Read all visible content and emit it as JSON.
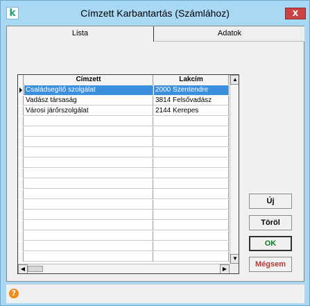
{
  "window": {
    "title": "Címzett Karbantartás (Számlához)",
    "app_icon": "k",
    "close_label": "X"
  },
  "tabs": [
    {
      "label": "Lista",
      "active": true
    },
    {
      "label": "Adatok",
      "active": false
    }
  ],
  "grid": {
    "columns": [
      "Címzett",
      "Lakcím"
    ],
    "rows": [
      {
        "cimzett": "Családsegítő szolgálat",
        "lakcim": "2000 Szentendre",
        "selected": true
      },
      {
        "cimzett": "Vadász társaság",
        "lakcim": "3814 Felsővadász",
        "selected": false
      },
      {
        "cimzett": "Városi járőrszolgálat",
        "lakcim": "2144 Kerepes",
        "selected": false
      }
    ]
  },
  "buttons": {
    "new": "Új",
    "delete": "Töröl",
    "ok": "OK",
    "cancel": "Mégsem"
  },
  "statusbar": {
    "help_icon": "?"
  },
  "colors": {
    "title_bar": "#a9d8f4",
    "selection": "#3b8fdf",
    "ok_text": "#0b7c1d",
    "cancel_text": "#b13a3a",
    "close_button": "#c94444",
    "help_icon": "#f08b1a"
  },
  "icons": [
    "app-icon",
    "close-icon",
    "help-icon",
    "scroll-up-icon",
    "scroll-down-icon",
    "scroll-left-icon",
    "scroll-right-icon",
    "row-pointer-icon"
  ]
}
